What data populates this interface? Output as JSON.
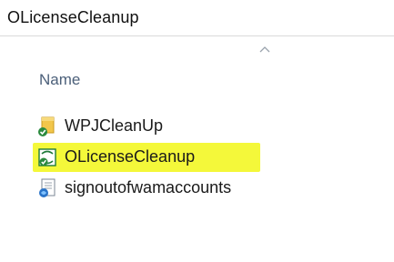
{
  "window": {
    "title": "OLicenseCleanup"
  },
  "header": {
    "column_name": "Name",
    "sort_icon": "chevron-up-icon"
  },
  "files": [
    {
      "name": "WPJCleanUp",
      "icon": "folder-icon",
      "highlighted": false
    },
    {
      "name": "OLicenseCleanup",
      "icon": "script-icon",
      "highlighted": true
    },
    {
      "name": "signoutofwamaccounts",
      "icon": "script-icon",
      "highlighted": false
    }
  ],
  "colors": {
    "highlight": "#f4f83a",
    "header_text": "#4c607a",
    "divider": "#d9d9d9"
  }
}
